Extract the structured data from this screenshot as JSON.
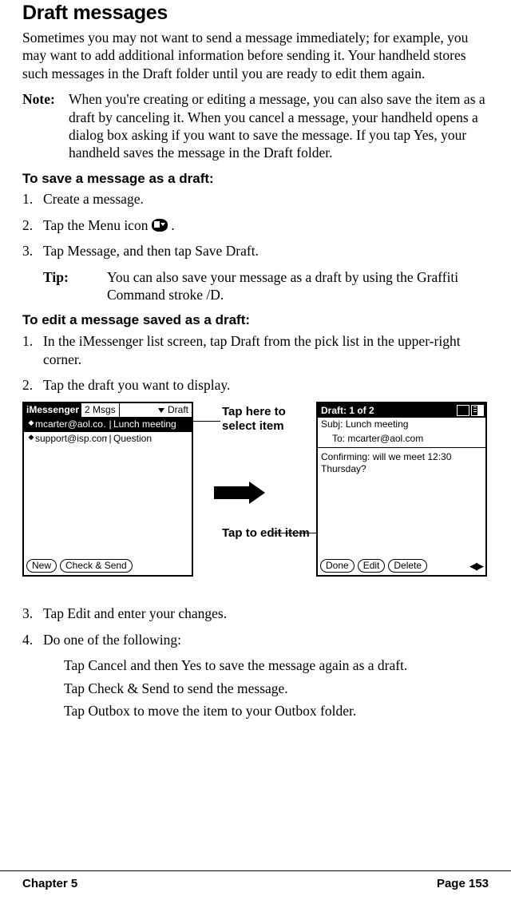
{
  "heading": "Draft messages",
  "intro": "Sometimes you may not want to send a message immediately; for example, you may want to add additional information before sending it. Your handheld stores such messages in the Draft folder until you are ready to edit them again.",
  "note_label": "Note:",
  "note_body": "When you're creating or editing a message, you can also save the item as a draft by canceling it. When you cancel a message, your handheld opens a dialog box asking if you want to save the message. If you tap Yes, your handheld saves the message in the Draft folder.",
  "save_heading": "To save a message as a draft:",
  "save_steps": {
    "s1_num": "1.",
    "s1_txt": "Create a message.",
    "s2_num": "2.",
    "s2_pre": "Tap the Menu icon ",
    "s2_post": " .",
    "s3_num": "3.",
    "s3_txt": "Tap Message, and then tap Save Draft."
  },
  "tip_label": "Tip:",
  "tip_body": "You can also save your message as a draft by using the Graffiti Command stroke /D.",
  "edit_heading": "To edit a message saved as a draft:",
  "edit_steps": {
    "s1_num": "1.",
    "s1_txt": "In the iMessenger list screen, tap Draft from the pick list in the upper-right corner.",
    "s2_num": "2.",
    "s2_txt": "Tap the draft you want to display."
  },
  "figure": {
    "left": {
      "app": "iMessenger",
      "count": "2 Msgs",
      "pick": "Draft",
      "rows": [
        {
          "from": "mcarter@aol.co…",
          "subj": "Lunch meeting"
        },
        {
          "from": "support@isp.com",
          "subj": "Question"
        }
      ],
      "btn_new": "New",
      "btn_check": "Check & Send"
    },
    "right": {
      "title": "Draft: 1 of 2",
      "subj_label": "Subj:",
      "subj_value": "Lunch meeting",
      "to_label": "To:",
      "to_value": "mcarter@aol.com",
      "body": "Confirming: will we meet 12:30 Thursday?",
      "btn_done": "Done",
      "btn_edit": "Edit",
      "btn_delete": "Delete"
    },
    "callout_select": "Tap here to select item",
    "callout_edit": "Tap to edit item"
  },
  "after_steps": {
    "s3_num": "3.",
    "s3_txt": "Tap Edit and enter your changes.",
    "s4_num": "4.",
    "s4_txt": "Do one of the following:",
    "opt1": "Tap Cancel and then Yes to save the message again as a draft.",
    "opt2": "Tap Check & Send to send the message.",
    "opt3": "Tap Outbox to move the item to your Outbox folder."
  },
  "footer_left": "Chapter 5",
  "footer_right": "Page 153"
}
